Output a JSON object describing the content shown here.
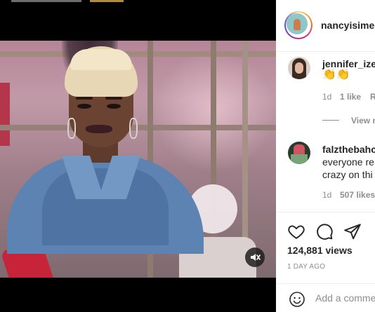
{
  "post": {
    "username": "nancyisime",
    "views": "124,881 views",
    "age": "1 DAY AGO"
  },
  "comments": [
    {
      "username": "jennifer_ize",
      "text": "👏👏",
      "time": "1d",
      "likes": "1 like",
      "reply": "R",
      "view_replies": "View r"
    },
    {
      "username": "falzthebahc",
      "lines": [
        "everyone re",
        "crazy on thi"
      ],
      "time": "1d",
      "likes": "507 likes"
    }
  ],
  "add_comment": {
    "placeholder": "Add a comme"
  },
  "icons": {
    "like": "heart-icon",
    "comment": "comment-icon",
    "share": "paper-plane-icon",
    "emoji": "smiley-icon",
    "mute": "speaker-muted-icon"
  },
  "colors": {
    "text": "#262626",
    "muted": "#8e8e8e",
    "border": "#efefef"
  }
}
